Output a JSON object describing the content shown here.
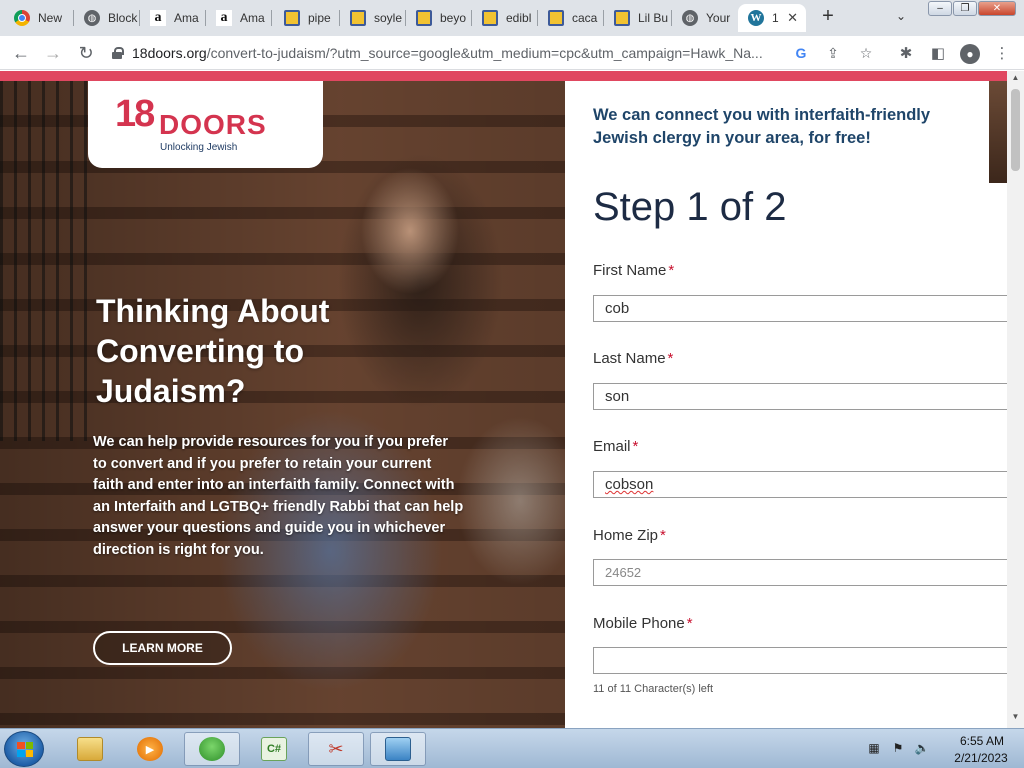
{
  "tabs": [
    {
      "label": "New",
      "icon": "chrome-icon"
    },
    {
      "label": "Block",
      "icon": "globe-icon"
    },
    {
      "label": "Ama",
      "icon": "amazon-icon"
    },
    {
      "label": "Ama",
      "icon": "amazon-icon"
    },
    {
      "label": "pipe",
      "icon": "shopping-bag-icon"
    },
    {
      "label": "soyle",
      "icon": "shopping-bag-icon"
    },
    {
      "label": "beyo",
      "icon": "shopping-bag-icon"
    },
    {
      "label": "edibl",
      "icon": "shopping-bag-icon"
    },
    {
      "label": "caca",
      "icon": "shopping-bag-icon"
    },
    {
      "label": "Lil Bu",
      "icon": "shopping-bag-icon"
    },
    {
      "label": "Your",
      "icon": "globe-icon"
    },
    {
      "label": "1",
      "icon": "wordpress-icon"
    }
  ],
  "address_bar": {
    "domain": "18doors.org",
    "path": "/convert-to-judaism/?utm_source=google&utm_medium=cpc&utm_campaign=Hawk_Na..."
  },
  "page": {
    "accent_color": "#e04760",
    "logo": {
      "mark": "18",
      "word": "DOORS",
      "tagline": "Unlocking Jewish"
    },
    "hero": {
      "title": "Thinking About Converting to Judaism?",
      "body": "We can help provide resources for you if you prefer to convert and if you prefer to retain your current faith and enter into an interfaith family. Connect with an Interfaith and LGTBQ+ friendly Rabbi that can help answer your questions and guide you in whichever direction is right for you.",
      "button": "LEARN MORE"
    },
    "form": {
      "intro": "We can connect you with interfaith-friendly Jewish clergy in your area, for free!",
      "step": "Step 1 of 2",
      "required_marker": "*",
      "fields": [
        {
          "label": "First Name",
          "value": "cob"
        },
        {
          "label": "Last Name",
          "value": "son"
        },
        {
          "label": "Email",
          "value": "cobson"
        },
        {
          "label": "Home Zip",
          "placeholder": "24652"
        },
        {
          "label": "Mobile Phone",
          "value": ""
        }
      ],
      "char_counter": "11 of 11 Character(s) left"
    }
  },
  "taskbar": {
    "time": "6:55 AM",
    "date": "2/21/2023"
  }
}
